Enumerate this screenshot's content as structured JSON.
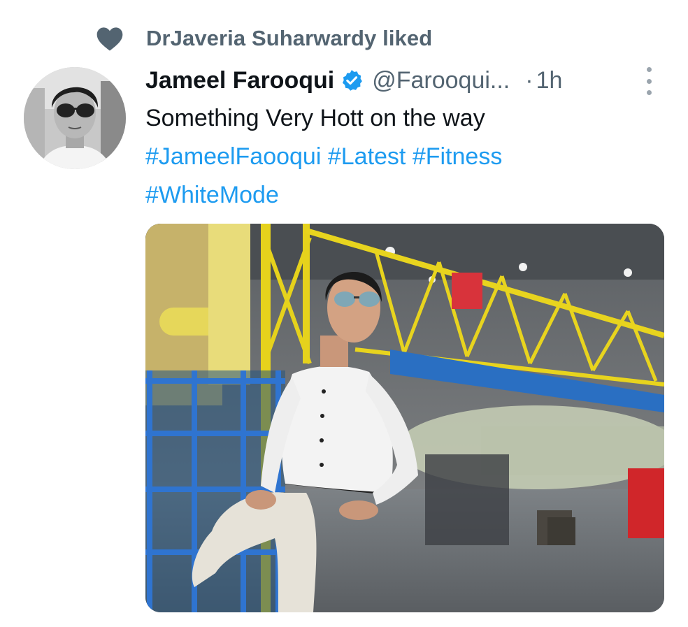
{
  "social_context": {
    "icon": "heart-icon",
    "text": "DrJaveria Suharwardy liked"
  },
  "tweet": {
    "author_name": "Jameel Farooqui",
    "verified_icon": "verified-badge-icon",
    "handle": "@Farooqui...",
    "separator": "·",
    "time": "1h",
    "more_icon": "more-vertical-icon",
    "text_line": "Something Very Hott on the way",
    "hashtags": [
      "#JameelFaooqui",
      "#Latest",
      "#Fitness",
      "#WhiteMode"
    ]
  },
  "colors": {
    "link": "#1d9bf0",
    "secondary_text": "#536471",
    "primary_text": "#0f1419"
  }
}
